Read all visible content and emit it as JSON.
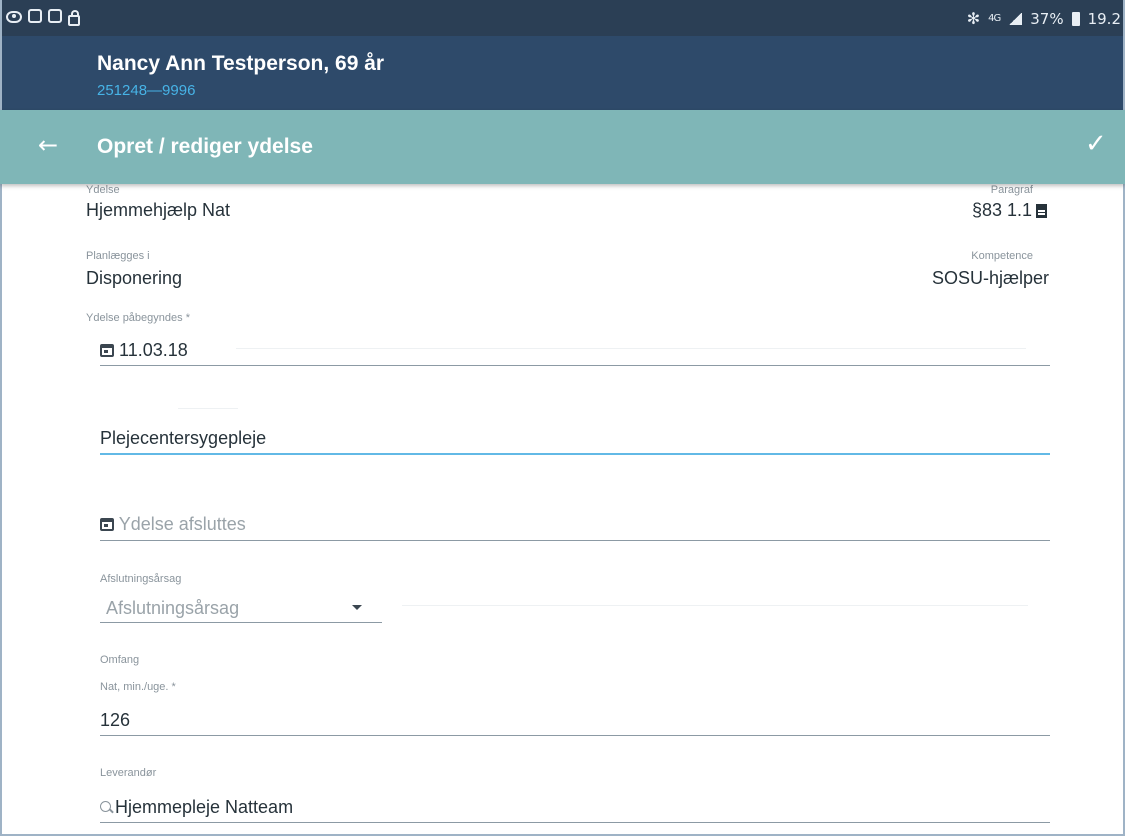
{
  "status_bar": {
    "battery": "37%",
    "time": "19.2",
    "network": "4G"
  },
  "patient": {
    "name": "Nancy Ann Testperson, 69 år",
    "id": "251248—9996"
  },
  "toolbar": {
    "title": "Opret / rediger ydelse"
  },
  "form": {
    "ydelse": {
      "label": "Ydelse",
      "value": "Hjemmehjælp Nat"
    },
    "paragraf": {
      "label": "Paragraf",
      "value": "§83 1.1"
    },
    "planlaegges": {
      "label": "Planlægges i",
      "value": "Disponering"
    },
    "kompetence": {
      "label": "Kompetence",
      "value": "SOSU-hjælper"
    },
    "start": {
      "label": "Ydelse påbegyndes *",
      "value": "11.03.18"
    },
    "plejecenter": {
      "value": "Plejecentersygepleje"
    },
    "end": {
      "placeholder": "Ydelse afsluttes"
    },
    "afslutningsaarsag": {
      "label": "Afslutningsårsag",
      "placeholder": "Afslutningsårsag"
    },
    "omfang": {
      "label": "Omfang",
      "sublabel": "Nat, min./uge. *",
      "value": "126"
    },
    "leverandoer": {
      "label": "Leverandør",
      "value": "Hjemmepleje Natteam"
    }
  },
  "colors": {
    "status_bar": "#2b3f55",
    "header": "#2e4a6a",
    "toolbar": "#7fb6b7",
    "accent": "#47b3e6"
  }
}
